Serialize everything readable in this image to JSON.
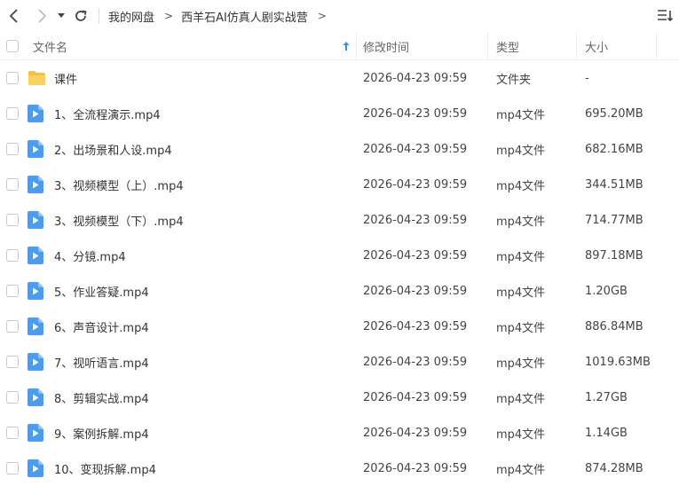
{
  "toolbar": {
    "breadcrumb": [
      "我的网盘",
      "西羊石AI仿真人剧实战营"
    ],
    "breadcrumb_separator": ">"
  },
  "columns": {
    "name": "文件名",
    "modified": "修改时间",
    "type": "类型",
    "size": "大小"
  },
  "files": [
    {
      "name": "课件",
      "modified": "2026-04-23 09:59",
      "type": "文件夹",
      "size": "-",
      "icon": "folder-icon"
    },
    {
      "name": "1、全流程演示.mp4",
      "modified": "2026-04-23 09:59",
      "type": "mp4文件",
      "size": "695.20MB",
      "icon": "video-file-icon"
    },
    {
      "name": "2、出场景和人设.mp4",
      "modified": "2026-04-23 09:59",
      "type": "mp4文件",
      "size": "682.16MB",
      "icon": "video-file-icon"
    },
    {
      "name": "3、视频模型（上）.mp4",
      "modified": "2026-04-23 09:59",
      "type": "mp4文件",
      "size": "344.51MB",
      "icon": "video-file-icon"
    },
    {
      "name": "3、视频模型（下）.mp4",
      "modified": "2026-04-23 09:59",
      "type": "mp4文件",
      "size": "714.77MB",
      "icon": "video-file-icon"
    },
    {
      "name": "4、分镜.mp4",
      "modified": "2026-04-23 09:59",
      "type": "mp4文件",
      "size": "897.18MB",
      "icon": "video-file-icon"
    },
    {
      "name": "5、作业答疑.mp4",
      "modified": "2026-04-23 09:59",
      "type": "mp4文件",
      "size": "1.20GB",
      "icon": "video-file-icon"
    },
    {
      "name": "6、声音设计.mp4",
      "modified": "2026-04-23 09:59",
      "type": "mp4文件",
      "size": "886.84MB",
      "icon": "video-file-icon"
    },
    {
      "name": "7、视听语言.mp4",
      "modified": "2026-04-23 09:59",
      "type": "mp4文件",
      "size": "1019.63MB",
      "icon": "video-file-icon"
    },
    {
      "name": "8、剪辑实战.mp4",
      "modified": "2026-04-23 09:59",
      "type": "mp4文件",
      "size": "1.27GB",
      "icon": "video-file-icon"
    },
    {
      "name": "9、案例拆解.mp4",
      "modified": "2026-04-23 09:59",
      "type": "mp4文件",
      "size": "1.14GB",
      "icon": "video-file-icon"
    },
    {
      "name": "10、变现拆解.mp4",
      "modified": "2026-04-23 09:59",
      "type": "mp4文件",
      "size": "874.28MB",
      "icon": "video-file-icon"
    }
  ],
  "colors": {
    "accent": "#3a8ee6",
    "folder": "#f7c244",
    "video": "#4a9cf0"
  }
}
